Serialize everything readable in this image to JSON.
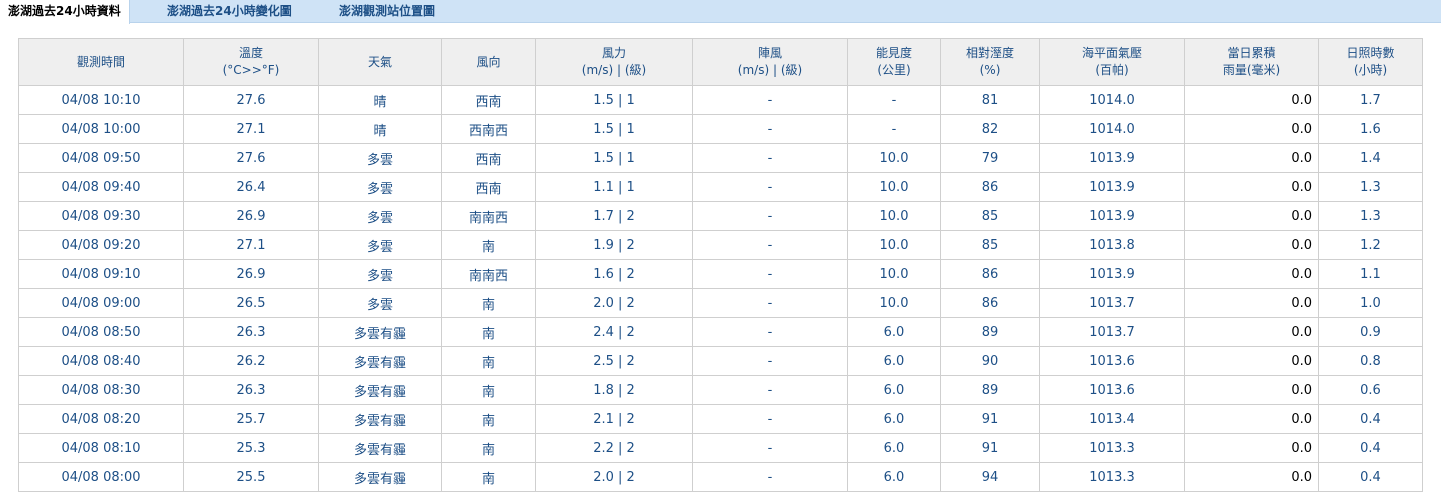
{
  "tabs": [
    {
      "label": "澎湖過去24小時資料",
      "active": true
    },
    {
      "label": "澎湖過去24小時變化圖",
      "active": false
    },
    {
      "label": "澎湖觀測站位置圖",
      "active": false
    }
  ],
  "columns": [
    {
      "line1": "觀測時間",
      "line2": ""
    },
    {
      "line1": "溫度",
      "line2": "(°C>>°F)"
    },
    {
      "line1": "天氣",
      "line2": ""
    },
    {
      "line1": "風向",
      "line2": ""
    },
    {
      "line1": "風力",
      "line2": "(m/s) | (級)"
    },
    {
      "line1": "陣風",
      "line2": "(m/s) | (級)"
    },
    {
      "line1": "能見度",
      "line2": "(公里)"
    },
    {
      "line1": "相對溼度",
      "line2": "(%)"
    },
    {
      "line1": "海平面氣壓",
      "line2": "(百帕)"
    },
    {
      "line1": "當日累積",
      "line2": "雨量(毫米)"
    },
    {
      "line1": "日照時數",
      "line2": "(小時)"
    }
  ],
  "rows": [
    [
      "04/08 10:10",
      "27.6",
      "晴",
      "西南",
      "1.5 | 1",
      "-",
      "-",
      "81",
      "1014.0",
      "0.0",
      "1.7"
    ],
    [
      "04/08 10:00",
      "27.1",
      "晴",
      "西南西",
      "1.5 | 1",
      "-",
      "-",
      "82",
      "1014.0",
      "0.0",
      "1.6"
    ],
    [
      "04/08 09:50",
      "27.6",
      "多雲",
      "西南",
      "1.5 | 1",
      "-",
      "10.0",
      "79",
      "1013.9",
      "0.0",
      "1.4"
    ],
    [
      "04/08 09:40",
      "26.4",
      "多雲",
      "西南",
      "1.1 | 1",
      "-",
      "10.0",
      "86",
      "1013.9",
      "0.0",
      "1.3"
    ],
    [
      "04/08 09:30",
      "26.9",
      "多雲",
      "南南西",
      "1.7 | 2",
      "-",
      "10.0",
      "85",
      "1013.9",
      "0.0",
      "1.3"
    ],
    [
      "04/08 09:20",
      "27.1",
      "多雲",
      "南",
      "1.9 | 2",
      "-",
      "10.0",
      "85",
      "1013.8",
      "0.0",
      "1.2"
    ],
    [
      "04/08 09:10",
      "26.9",
      "多雲",
      "南南西",
      "1.6 | 2",
      "-",
      "10.0",
      "86",
      "1013.9",
      "0.0",
      "1.1"
    ],
    [
      "04/08 09:00",
      "26.5",
      "多雲",
      "南",
      "2.0 | 2",
      "-",
      "10.0",
      "86",
      "1013.7",
      "0.0",
      "1.0"
    ],
    [
      "04/08 08:50",
      "26.3",
      "多雲有霾",
      "南",
      "2.4 | 2",
      "-",
      "6.0",
      "89",
      "1013.7",
      "0.0",
      "0.9"
    ],
    [
      "04/08 08:40",
      "26.2",
      "多雲有霾",
      "南",
      "2.5 | 2",
      "-",
      "6.0",
      "90",
      "1013.6",
      "0.0",
      "0.8"
    ],
    [
      "04/08 08:30",
      "26.3",
      "多雲有霾",
      "南",
      "1.8 | 2",
      "-",
      "6.0",
      "89",
      "1013.6",
      "0.0",
      "0.6"
    ],
    [
      "04/08 08:20",
      "25.7",
      "多雲有霾",
      "南",
      "2.1 | 2",
      "-",
      "6.0",
      "91",
      "1013.4",
      "0.0",
      "0.4"
    ],
    [
      "04/08 08:10",
      "25.3",
      "多雲有霾",
      "南",
      "2.2 | 2",
      "-",
      "6.0",
      "91",
      "1013.3",
      "0.0",
      "0.4"
    ],
    [
      "04/08 08:00",
      "25.5",
      "多雲有霾",
      "南",
      "2.0 | 2",
      "-",
      "6.0",
      "94",
      "1013.3",
      "0.0",
      "0.4"
    ]
  ]
}
